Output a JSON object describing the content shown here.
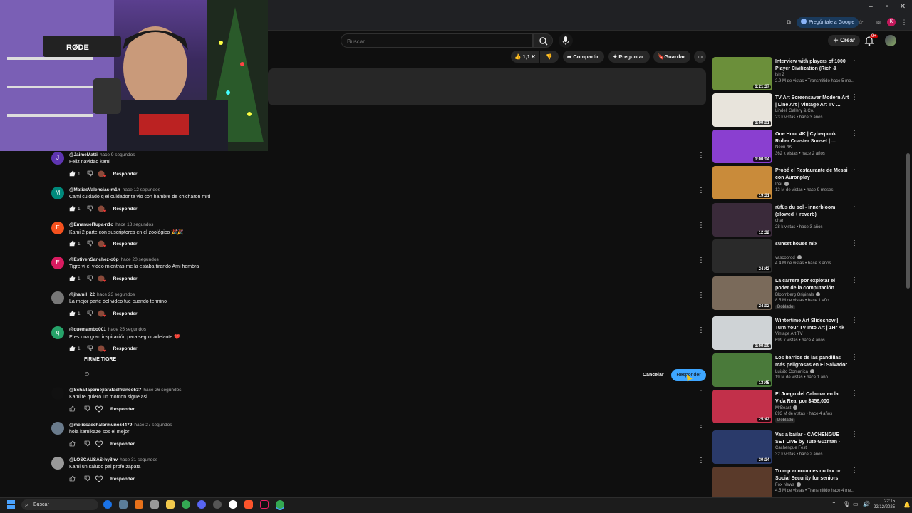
{
  "browser": {
    "ask_google": "Pregúntale a Google",
    "profile_initial": "K"
  },
  "header": {
    "search_placeholder": "Buscar",
    "create_label": "Crear",
    "notifications_badge": "9+"
  },
  "actions": {
    "likes": "1,1 K",
    "share": "Compartir",
    "ask": "Preguntar",
    "save": "Guardar"
  },
  "webcam": {
    "mic_brand": "RØDE"
  },
  "comments": [
    {
      "author": "@JaimeMatti",
      "time": "hace 9 segundos",
      "text": "Feliz navidad kami",
      "likes": "1",
      "reply": "Responder",
      "initial": "J",
      "color": "#5e35b1"
    },
    {
      "author": "@MatiasValencias-m1n",
      "time": "hace 12 segundos",
      "text": "Cami cuidado q el cuidador te vio con hambre de chicharon mrd",
      "likes": "1",
      "reply": "Responder",
      "initial": "M",
      "color": "#00897b"
    },
    {
      "author": "@EmanuelTupa-n1o",
      "time": "hace 18 segundos",
      "text": "Kami 2 parte con suscriptores  en el zoológico 🎉🎉",
      "likes": "1",
      "reply": "Responder",
      "initial": "E",
      "color": "#f4511e"
    },
    {
      "author": "@EstivenSanchez-o6p",
      "time": "hace 20 segundos",
      "text": "Tigre vi el video mientras me la estaba tirando Ami hembra",
      "likes": "1",
      "reply": "Responder",
      "initial": "E",
      "color": "#d81b60"
    },
    {
      "author": "@jhamil_22",
      "time": "hace 23 segundos",
      "text": "La mejor parte del video fue cuando termino",
      "likes": "1",
      "reply": "Responder",
      "initial": "",
      "color": "#777"
    },
    {
      "author": "@quemambo001",
      "time": "hace 25 segundos",
      "text": "Eres una gran inspiración para seguir adelante ❤️",
      "likes": "1",
      "reply": "Responder",
      "initial": "q",
      "color": "#26a269"
    },
    {
      "author": "@Schallapamejiarafaelfranco537",
      "time": "hace 26 segundos",
      "text": "Kami te quiero un monton sigue asi",
      "likes": "",
      "reply": "Responder",
      "initial": "",
      "color": "#111"
    },
    {
      "author": "@melissaechalarmunoz4479",
      "time": "hace 27 segundos",
      "text": "hola kamikaze sos el mejor",
      "likes": "",
      "reply": "Responder",
      "initial": "",
      "color": "#6a7b8c"
    },
    {
      "author": "@LOSCAUSAS-hy8hv",
      "time": "hace 31 segundos",
      "text": "Kami un saludo pal profe zapata",
      "likes": "",
      "reply": "Responder",
      "initial": "",
      "color": "#999"
    }
  ],
  "reply_box": {
    "text": "FIRME TIGRE",
    "cancel": "Cancelar",
    "submit": "Responder"
  },
  "sidebar": [
    {
      "title": "Interview with players of 1000 Player Civilization (Rich & Poor)",
      "channel": "ish 2",
      "meta": "2.9 M de vistas • Transmitido hace 5 me...",
      "duration": "1:21:37",
      "badge": "",
      "verified": false,
      "thumb": "#6b8f3a"
    },
    {
      "title": "TV Art Screensaver Modern Art | Line Art | Vintage Art TV ...",
      "channel": "Lindell Gallery & Co.",
      "meta": "23 k vistas • hace 3 años",
      "duration": "1:00:01",
      "badge": "",
      "verified": false,
      "thumb": "#e8e4dc"
    },
    {
      "title": "One Hour 4K | Cyberpunk Roller Coaster Sunset | ...",
      "channel": "Neon 4K",
      "meta": "362 k vistas • hace 2 años",
      "duration": "1:00:04",
      "badge": "",
      "verified": false,
      "thumb": "#8a3fd0"
    },
    {
      "title": "Probé el Restaurante de Messi con Auronplay",
      "channel": "Ibai",
      "meta": "12 M de vistas • hace 9 meses",
      "duration": "19:31",
      "badge": "",
      "verified": true,
      "thumb": "#c98b3a"
    },
    {
      "title": "rüfüs du sol - innerbloom (slowed + reverb)",
      "channel": "charl",
      "meta": "28 k vistas • hace 3 años",
      "duration": "12:32",
      "badge": "",
      "verified": false,
      "thumb": "#3a2a3a"
    },
    {
      "title": "sunset house mix",
      "channel": "vascoprod",
      "meta": "4.4 M de vistas • hace 3 años",
      "duration": "24:42",
      "badge": "",
      "verified": true,
      "thumb": "#2a2a2a"
    },
    {
      "title": "La carrera por explotar el poder de la computación cuántica | ...",
      "channel": "Bloomberg Originals",
      "meta": "8.5 M de vistas • hace 1 año",
      "duration": "24:02",
      "badge": "Doblado",
      "verified": true,
      "thumb": "#7a6a5a"
    },
    {
      "title": "Wintertime Art Slideshow | Turn Your TV Into Art | 1Hr 4k HD ...",
      "channel": "Vintage Art TV",
      "meta": "699 k vistas • hace 4 años",
      "duration": "1:00:00",
      "badge": "",
      "verified": false,
      "thumb": "#cfd3d6"
    },
    {
      "title": "Los barrios de las pandillas más peligrosas en El Salvador | ...",
      "channel": "Luisito Comunica",
      "meta": "19 M de vistas • hace 1 año",
      "duration": "13:45",
      "badge": "",
      "verified": true,
      "thumb": "#4a7a3a"
    },
    {
      "title": "El Juego del Calamar en la Vida Real por $456,000",
      "channel": "MrBeast",
      "meta": "893 M de vistas • hace 4 años",
      "duration": "25:42",
      "badge": "Doblado",
      "verified": true,
      "thumb": "#c2304a"
    },
    {
      "title": "Vas a bailar - CACHENGUE SET LIVE by Tute Guzman - WARM ...",
      "channel": "Cachengue Fest",
      "meta": "32 k vistas • hace 2 años",
      "duration": "30:14",
      "badge": "",
      "verified": false,
      "thumb": "#2a3a6a"
    },
    {
      "title": "Trump announces no tax on Social Security for seniors",
      "channel": "Fox News",
      "meta": "4.5 M de vistas • Transmitido hace 4 me...",
      "duration": "",
      "badge": "",
      "verified": true,
      "thumb": "#5a3a2a"
    }
  ],
  "taskbar": {
    "search": "Buscar",
    "time": "22:15",
    "date": "22/12/2025"
  }
}
